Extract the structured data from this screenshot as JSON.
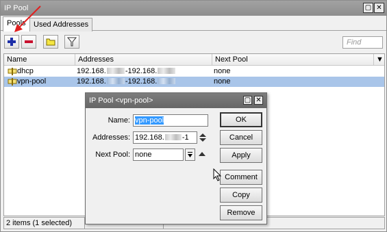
{
  "window": {
    "title": "IP Pool"
  },
  "tabs": [
    {
      "label": "Pools"
    },
    {
      "label": "Used Addresses"
    }
  ],
  "toolbar": {
    "find_placeholder": "Find"
  },
  "table": {
    "columns": [
      "Name",
      "Addresses",
      "Next Pool"
    ],
    "rows": [
      {
        "name": "dhcp",
        "addr_start": "192.168.",
        "addr_mid": "-192.168.",
        "next_pool": "none",
        "selected": false
      },
      {
        "name": "vpn-pool",
        "addr_start": "192.168.",
        "addr_mid": "-192.168.",
        "next_pool": "none",
        "selected": true
      }
    ]
  },
  "status": {
    "text": "2 items (1 selected)"
  },
  "dialog": {
    "title": "IP Pool <vpn-pool>",
    "name_label": "Name:",
    "name_value": "vpn-pool",
    "addresses_label": "Addresses:",
    "addresses_value_start": "192.168.",
    "addresses_value_end": "-1",
    "next_pool_label": "Next Pool:",
    "next_pool_value": "none",
    "buttons": {
      "ok": "OK",
      "cancel": "Cancel",
      "apply": "Apply",
      "comment": "Comment",
      "copy": "Copy",
      "remove": "Remove"
    }
  },
  "colors": {
    "selection": "#a9c5e9",
    "add_icon": "#1e2fa8",
    "remove_icon": "#c8102e",
    "annotation_arrow": "#e02020"
  }
}
